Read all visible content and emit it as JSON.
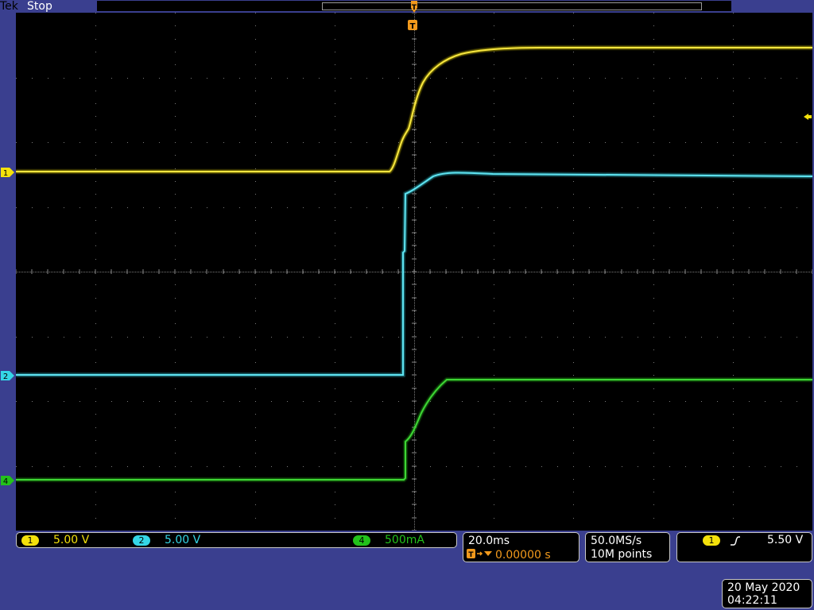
{
  "header": {
    "brand": "Tek",
    "status": "Stop"
  },
  "trigger_marker": "T",
  "channels": [
    {
      "id": "1",
      "label": "1",
      "scale": "5.00 V",
      "color": "#f4e10b"
    },
    {
      "id": "2",
      "label": "2",
      "scale": "5.00 V",
      "color": "#35d6e6"
    },
    {
      "id": "4",
      "label": "4",
      "scale": "500mA",
      "color": "#23c21b"
    }
  ],
  "timebase": {
    "scale": "20.0ms",
    "position": "0.00000 s",
    "marker": "T"
  },
  "acquisition": {
    "rate": "50.0MS/s",
    "length": "10M points"
  },
  "trigger": {
    "source": "1",
    "slope": "rising",
    "level": "5.50 V"
  },
  "datetime": {
    "date": "20 May 2020",
    "time": "04:22:11"
  },
  "colors": {
    "background": "#3a3f8f",
    "accent": "#f39a1c"
  }
}
